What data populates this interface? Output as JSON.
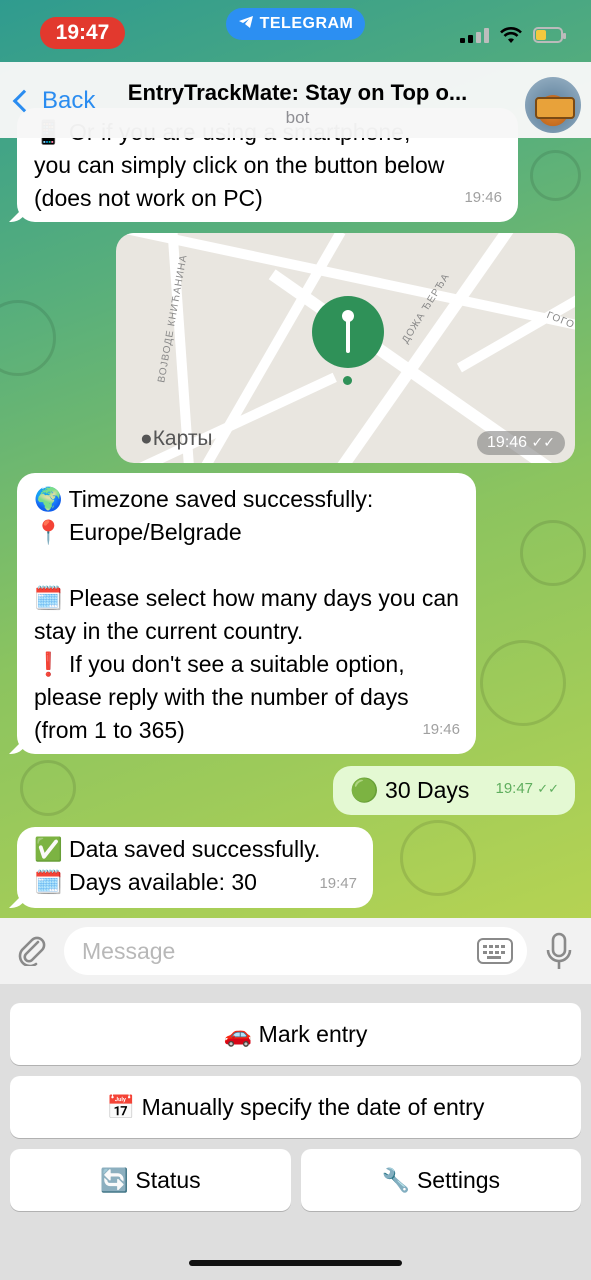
{
  "status_bar": {
    "time": "19:47",
    "app_pill": "TELEGRAM"
  },
  "header": {
    "back_label": "Back",
    "title": "EntryTrackMate: Stay on Top o...",
    "subtitle": "bot"
  },
  "messages": {
    "m1": {
      "text": "you can simply click on the button below\n(does not work on PC)",
      "time": "19:46",
      "partial_top": "📱 Or if you are using a smartphone,"
    },
    "map": {
      "label": "Карты",
      "time": "19:46",
      "streets": [
        "ВОЈВОДЕ КНИЋАНИНА",
        "ДОЖА ЂЕРЂА",
        "ГОГО"
      ]
    },
    "m2": {
      "text": "🌍 Timezone saved successfully:\n📍 Europe/Belgrade\n\n🗓️ Please select how many days you can stay in the current country.\n❗ If you don't see a suitable option, please reply with the number of days (from 1 to 365)",
      "time": "19:46"
    },
    "m3": {
      "text": "🟢 30 Days",
      "time": "19:47"
    },
    "m4": {
      "text": "✅ Data saved successfully.\n🗓️ Days available: 30",
      "time": "19:47"
    }
  },
  "input": {
    "placeholder": "Message"
  },
  "keyboard": {
    "mark_entry": "🚗 Mark entry",
    "manual_date": "📅 Manually specify the date of entry",
    "status": "🔄 Status",
    "settings": "🔧 Settings"
  }
}
